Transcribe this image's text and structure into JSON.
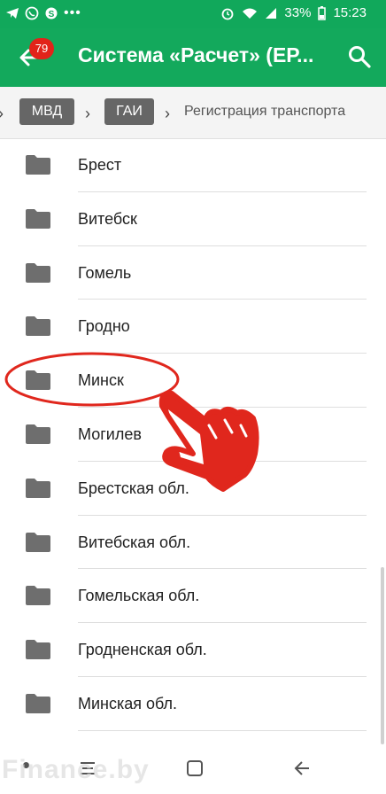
{
  "status_bar": {
    "battery": "33%",
    "time": "15:23",
    "icons": [
      "telegram-icon",
      "viber-icon",
      "skype-icon",
      "more-dots-icon",
      "alarm-icon",
      "wifi-icon",
      "signal-icon",
      "battery-icon"
    ]
  },
  "app_bar": {
    "title": "Система «Расчет» (ЕР...",
    "badge": "79",
    "icons": [
      "back-arrow-icon",
      "search-icon"
    ]
  },
  "breadcrumbs": [
    "МВД",
    "ГАИ",
    "Регистрация транспорта"
  ],
  "folders": [
    "Брест",
    "Витебск",
    "Гомель",
    "Гродно",
    "Минск",
    "Могилев",
    "Брестская обл.",
    "Витебская обл.",
    "Гомельская обл.",
    "Гродненская обл.",
    "Минская обл."
  ],
  "watermark": "Finance.by",
  "colors": {
    "primary": "#13a95c",
    "badge": "#e2231a",
    "annotation": "#e0271d",
    "chip": "#666666"
  }
}
